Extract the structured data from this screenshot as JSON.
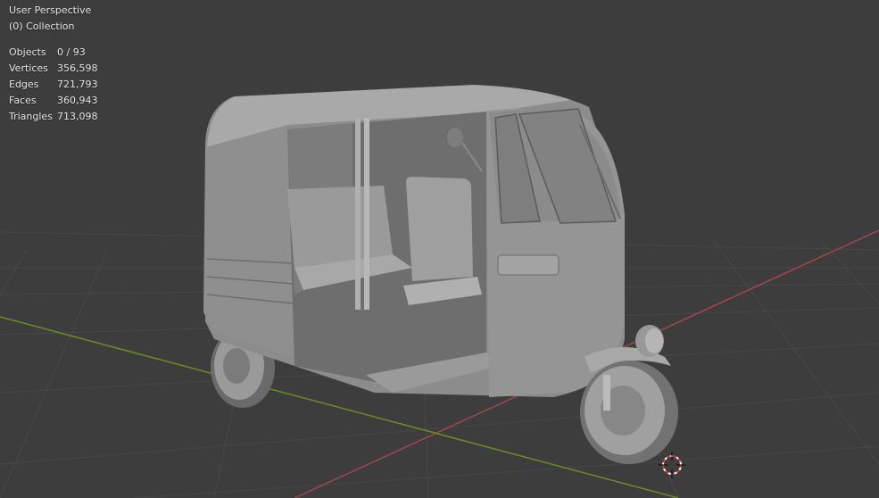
{
  "viewport": {
    "view_name": "User Perspective",
    "collection": "(0) Collection",
    "stats": [
      {
        "label": "Objects",
        "value": "0 / 93"
      },
      {
        "label": "Vertices",
        "value": "356,598"
      },
      {
        "label": "Edges",
        "value": "721,793"
      },
      {
        "label": "Faces",
        "value": "360,943"
      },
      {
        "label": "Triangles",
        "value": "713,098"
      }
    ]
  },
  "colors": {
    "background": "#3d3d3d",
    "grid_line": "#494949",
    "x_axis": "#a3454c",
    "y_axis": "#6b8e23",
    "model_fill": "#8c8c8c",
    "model_light": "#a7a7a7",
    "model_dark": "#5b5b5b",
    "cursor_red": "#e33a3a"
  },
  "icons": {
    "model": "auto-rickshaw-mesh",
    "cursor": "3d-cursor-icon"
  }
}
